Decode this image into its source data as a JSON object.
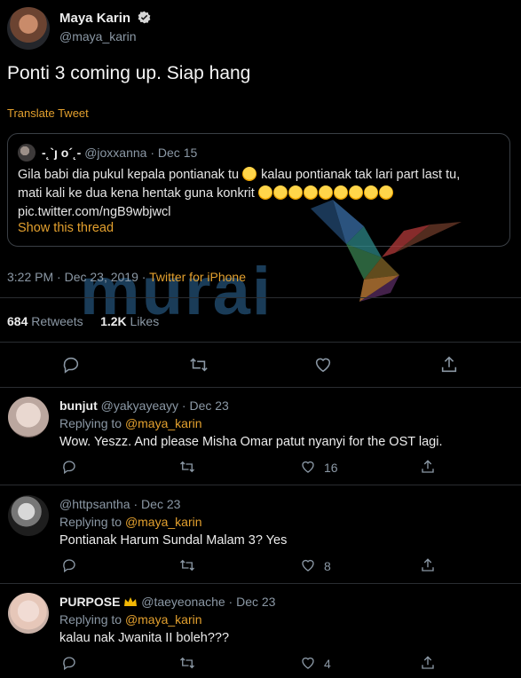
{
  "author": {
    "name": "Maya Karin",
    "handle": "@maya_karin"
  },
  "tweet": {
    "text": "Ponti 3 coming up. Siap hang",
    "translate_label": "Translate Tweet",
    "timestamp": "3:22 PM · Dec 23, 2019 · ",
    "source": "Twitter for iPhone"
  },
  "quote": {
    "name": "-˛`ȷ o´˛-",
    "handle": "@joxxanna",
    "date": "· Dec 15",
    "line1": "Gila babi dia pukul kepala pontianak tu",
    "line1_after": "kalau pontianak tak lari part last tu,",
    "line2": "mati kali ke dua kena hentak guna konkrit",
    "link": "pic.twitter.com/ngB9wbjwcl",
    "show_thread": "Show this thread"
  },
  "watermark": "murai",
  "stats": {
    "retweets_count": "684",
    "retweets_label": "Retweets",
    "likes_count": "1.2K",
    "likes_label": "Likes"
  },
  "icons": {
    "accent": "#e3a02e",
    "muted": "#8b98a5",
    "verified_bg": "#d6d6d6"
  },
  "replies": [
    {
      "name": "bunjut",
      "handle": "@yakyayeayy",
      "date": "· Dec 23",
      "replying_prefix": "Replying to ",
      "mention": "@maya_karin",
      "text": "Wow. Yeszz. And please Misha Omar patut nyanyi for the OST lagi.",
      "likes": "16"
    },
    {
      "name": "",
      "handle": "@httpsantha",
      "date": "· Dec 23",
      "replying_prefix": "Replying to ",
      "mention": "@maya_karin",
      "text": "Pontianak Harum Sundal Malam 3? Yes",
      "likes": "8"
    },
    {
      "name": "PURPOSE",
      "handle": "@taeyeonache",
      "date": "· Dec 23",
      "replying_prefix": "Replying to ",
      "mention": "@maya_karin",
      "text": "kalau nak Jwanita II boleh???",
      "likes": "4"
    }
  ]
}
